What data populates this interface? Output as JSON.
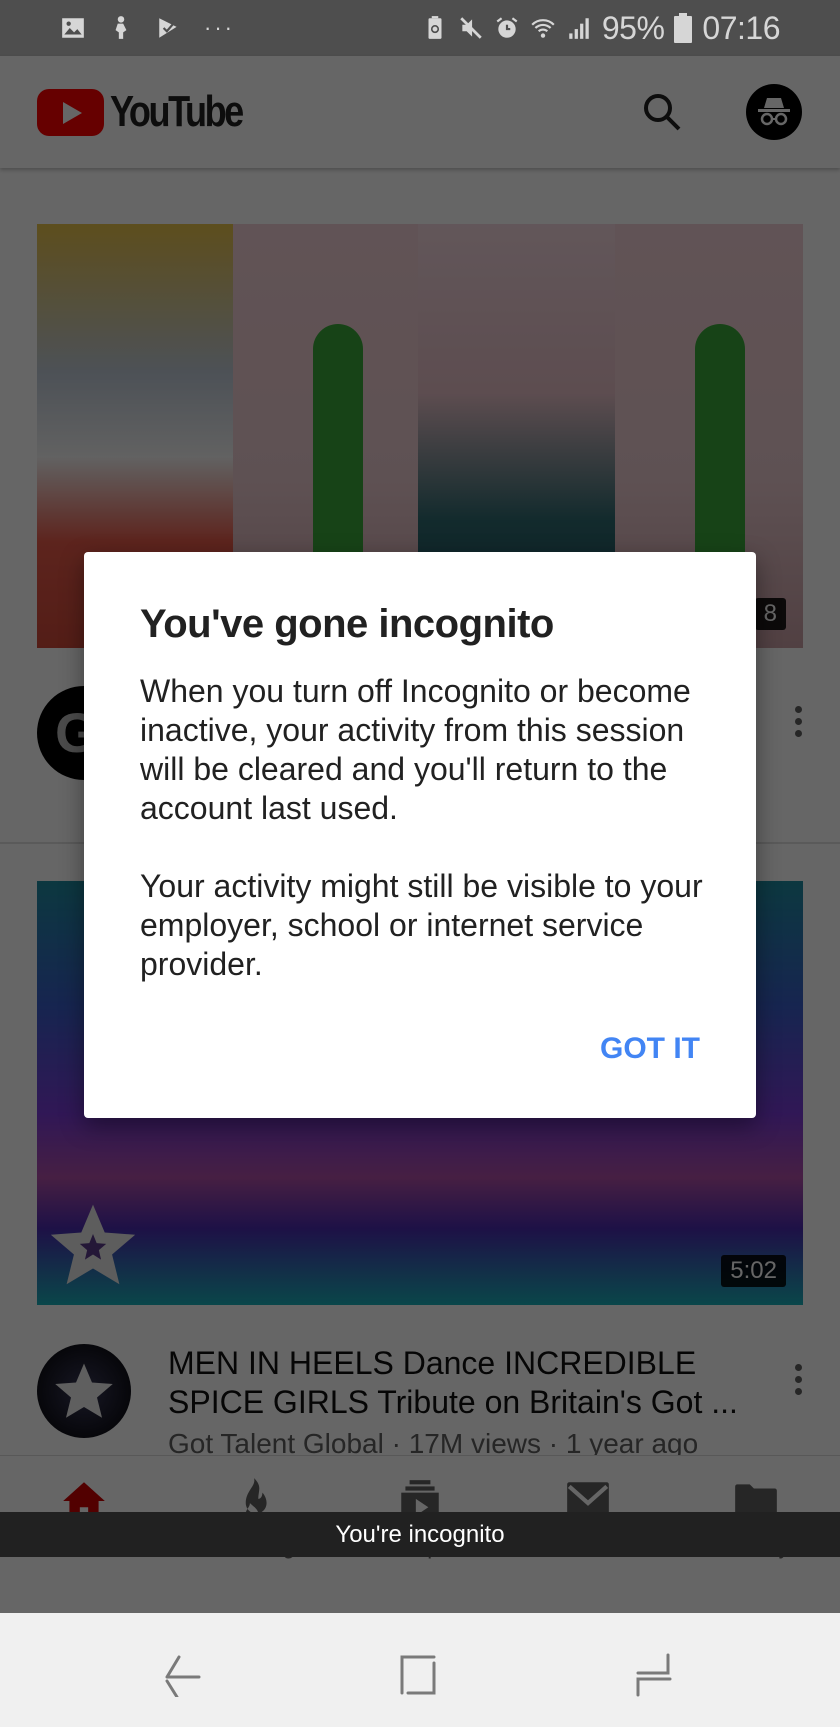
{
  "status_bar": {
    "left_icons": [
      "gallery-icon",
      "pregnancy-app-icon",
      "check-app-icon",
      "more-notifications-icon"
    ],
    "more_dots": "···",
    "right_icons": [
      "battery-saver-icon",
      "mute-icon",
      "alarm-icon",
      "wifi-icon",
      "signal-icon"
    ],
    "battery_percent": "95%",
    "time": "07:16"
  },
  "app_bar": {
    "logo_text": "YouTube",
    "search_icon": "search-icon",
    "account_icon": "incognito-icon"
  },
  "feed": {
    "videos": [
      {
        "duration": "8",
        "title": "",
        "meta": "",
        "channel_initial": "G"
      },
      {
        "duration": "5:02",
        "title": "MEN IN HEELS Dance INCREDIBLE SPICE GIRLS Tribute on Britain's Got ...",
        "meta": "Got Talent Global · 17M views · 1 year ago"
      }
    ]
  },
  "bottom_nav": {
    "items": [
      {
        "label": "Home",
        "icon": "home-icon",
        "active": true
      },
      {
        "label": "Trending",
        "icon": "flame-icon",
        "active": false
      },
      {
        "label": "Subscriptions",
        "icon": "subscriptions-icon",
        "active": false
      },
      {
        "label": "Inbox",
        "icon": "mail-icon",
        "active": false
      },
      {
        "label": "Library",
        "icon": "folder-icon",
        "active": false
      }
    ]
  },
  "incognito_banner": "You're incognito",
  "dialog": {
    "title": "You've gone incognito",
    "paragraph_1": "When you turn off Incognito or become inactive, your activity from this session will be cleared and you'll return to the account last used.",
    "paragraph_2": "Your activity might still be visible to your employer, school or internet service provider.",
    "confirm_label": "GOT IT"
  },
  "colors": {
    "brand_red": "#ff0000",
    "active_nav": "#cc0000",
    "dialog_button": "#4285f4"
  }
}
